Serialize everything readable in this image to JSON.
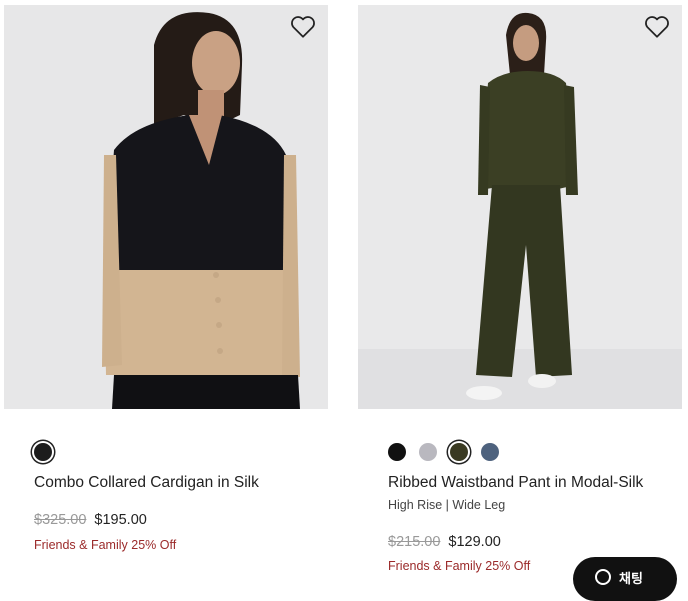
{
  "products": [
    {
      "name": "Combo Collared Cardigan in Silk",
      "subtitle": "",
      "price_original": "$325.00",
      "price_sale": "$195.00",
      "promo": "Friends & Family 25% Off",
      "swatches": [
        "#1c1c1c"
      ],
      "selected_swatch": 0
    },
    {
      "name": "Ribbed Waistband Pant in Modal-Silk",
      "subtitle": "High Rise | Wide Leg",
      "price_original": "$215.00",
      "price_sale": "$129.00",
      "promo": "Friends & Family 25% Off",
      "swatches": [
        "#111111",
        "#b9b8bf",
        "#3a3a22",
        "#4e627e"
      ],
      "selected_swatch": 2
    }
  ],
  "chat": {
    "label": "채팅"
  },
  "icons": {
    "wishlist": "heart-outline-icon",
    "chat": "search-chat-icon"
  }
}
